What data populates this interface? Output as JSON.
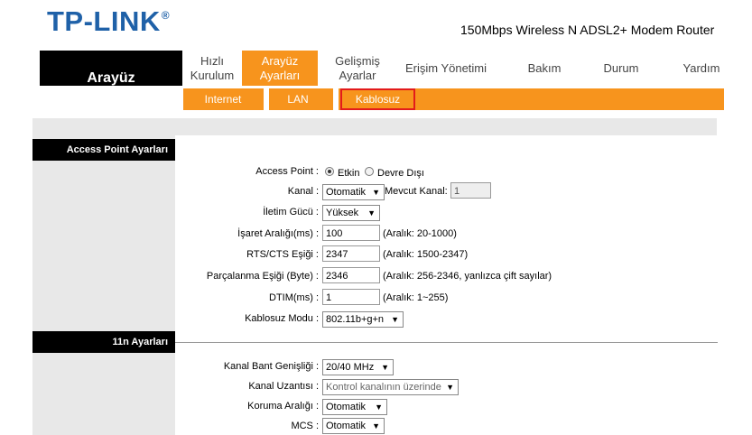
{
  "header": {
    "logo": "TP-LINK",
    "registered": "®",
    "model": "150Mbps Wireless N ADSL2+ Modem Router"
  },
  "nav": {
    "current": "Arayüz",
    "items": [
      "Hızlı Kurulum",
      "Arayüz Ayarları",
      "Gelişmiş Ayarlar",
      "Erişim Yönetimi",
      "Bakım",
      "Durum",
      "Yardım"
    ],
    "active": "Arayüz Ayarları",
    "sub": [
      "Internet",
      "LAN",
      "Kablosuz"
    ],
    "sub_selected": "Kablosuz"
  },
  "ap_section": {
    "title": "Access Point Ayarları",
    "access_point_label": "Access Point :",
    "access_point_on": "Etkin",
    "access_point_off": "Devre Dışı",
    "channel_label": "Kanal :",
    "channel_value": "Otomatik",
    "current_channel_label": "Mevcut Kanal:",
    "current_channel_value": "1",
    "tx_power_label": "İletim Gücü :",
    "tx_power_value": "Yüksek",
    "beacon_label": "İşaret Aralığı(ms) :",
    "beacon_value": "100",
    "beacon_hint": "(Aralık: 20-1000)",
    "rts_label": "RTS/CTS Eşiği :",
    "rts_value": "2347",
    "rts_hint": "(Aralık: 1500-2347)",
    "frag_label": "Parçalanma Eşiği (Byte) :",
    "frag_value": "2346",
    "frag_hint": "(Aralık: 256-2346, yanlızca çift sayılar)",
    "dtim_label": "DTIM(ms) :",
    "dtim_value": "1",
    "dtim_hint": "(Aralık: 1~255)",
    "mode_label": "Kablosuz Modu :",
    "mode_value": "802.11b+g+n"
  },
  "n_section": {
    "title": "11n Ayarları",
    "bandwidth_label": "Kanal Bant Genişliği :",
    "bandwidth_value": "20/40 MHz",
    "ext_label": "Kanal Uzantısı :",
    "ext_value": "Kontrol kanalının üzerinde",
    "guard_label": "Koruma Aralığı :",
    "guard_value": "Otomatik",
    "mcs_label": "MCS :",
    "mcs_value": "Otomatik"
  }
}
